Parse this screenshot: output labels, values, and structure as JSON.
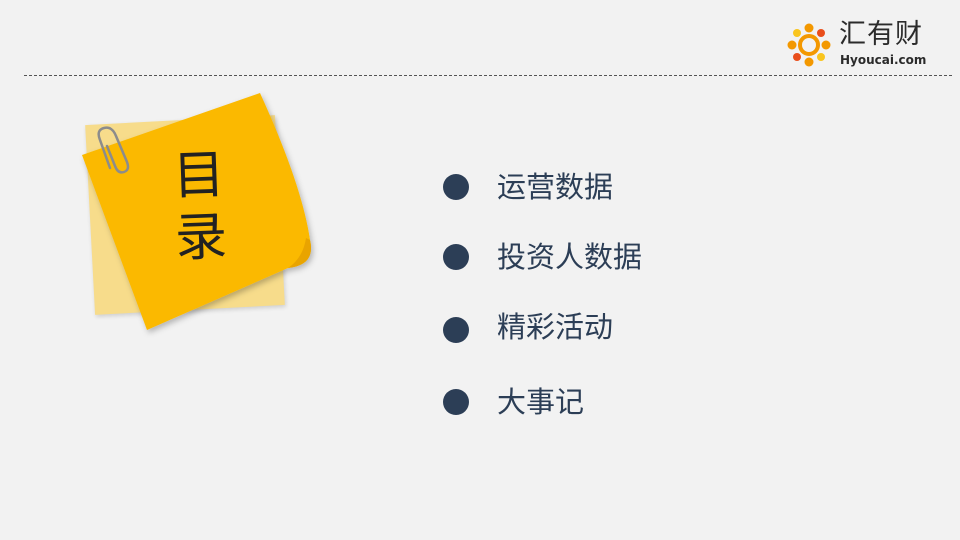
{
  "brand": {
    "name_cn": "汇有财",
    "name_en": "Hyoucai.com",
    "colors": {
      "orange": "#f39800",
      "red": "#e94e1b",
      "yellow": "#f9c51e"
    }
  },
  "note": {
    "title": "目录",
    "color": "#fbb900",
    "clip_icon": "paperclip-icon"
  },
  "menu": {
    "bullet_color": "#2c3e56",
    "items": [
      {
        "label": "运营数据"
      },
      {
        "label": "投资人数据"
      },
      {
        "label": "精彩活动"
      },
      {
        "label": "大事记"
      }
    ]
  }
}
